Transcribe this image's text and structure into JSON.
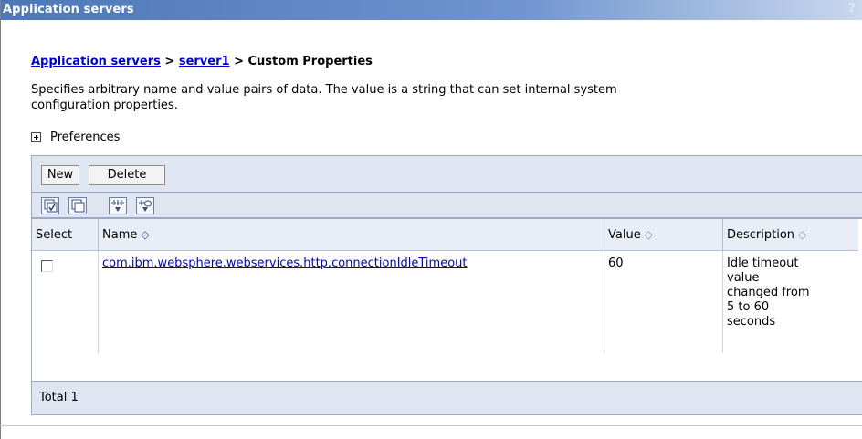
{
  "window": {
    "title": "Application servers",
    "help_label": "?"
  },
  "breadcrumb": {
    "items": [
      "Application servers",
      "server1",
      "Custom Properties"
    ],
    "separator": ">"
  },
  "description": {
    "line1": "Specifies arbitrary name and value pairs of data. The value is a string that can set internal system",
    "line2": "configuration properties."
  },
  "preferences": {
    "label": "Preferences",
    "icon": "expand-plus-icon"
  },
  "toolbar": {
    "new_label": "New",
    "delete_label": "Delete",
    "icons": [
      "select-all-icon",
      "deselect-all-icon",
      "show-filter-icon",
      "clear-filter-icon"
    ]
  },
  "table": {
    "headers": {
      "select": "Select",
      "name": "Name",
      "value": "Value",
      "description": "Description"
    },
    "sort_symbol": "◇",
    "rows": [
      {
        "selected": false,
        "name": "com.ibm.websphere.webservices.http.connectionIdleTimeout",
        "value": "60",
        "description_lines": [
          "Idle timeout",
          "value",
          "changed from",
          "5 to 60",
          "seconds"
        ]
      }
    ],
    "total": "Total 1"
  },
  "colors": {
    "title_bar": "#4d77b6",
    "link": "#0000cc",
    "panel_bg": "#dfe5f1"
  }
}
